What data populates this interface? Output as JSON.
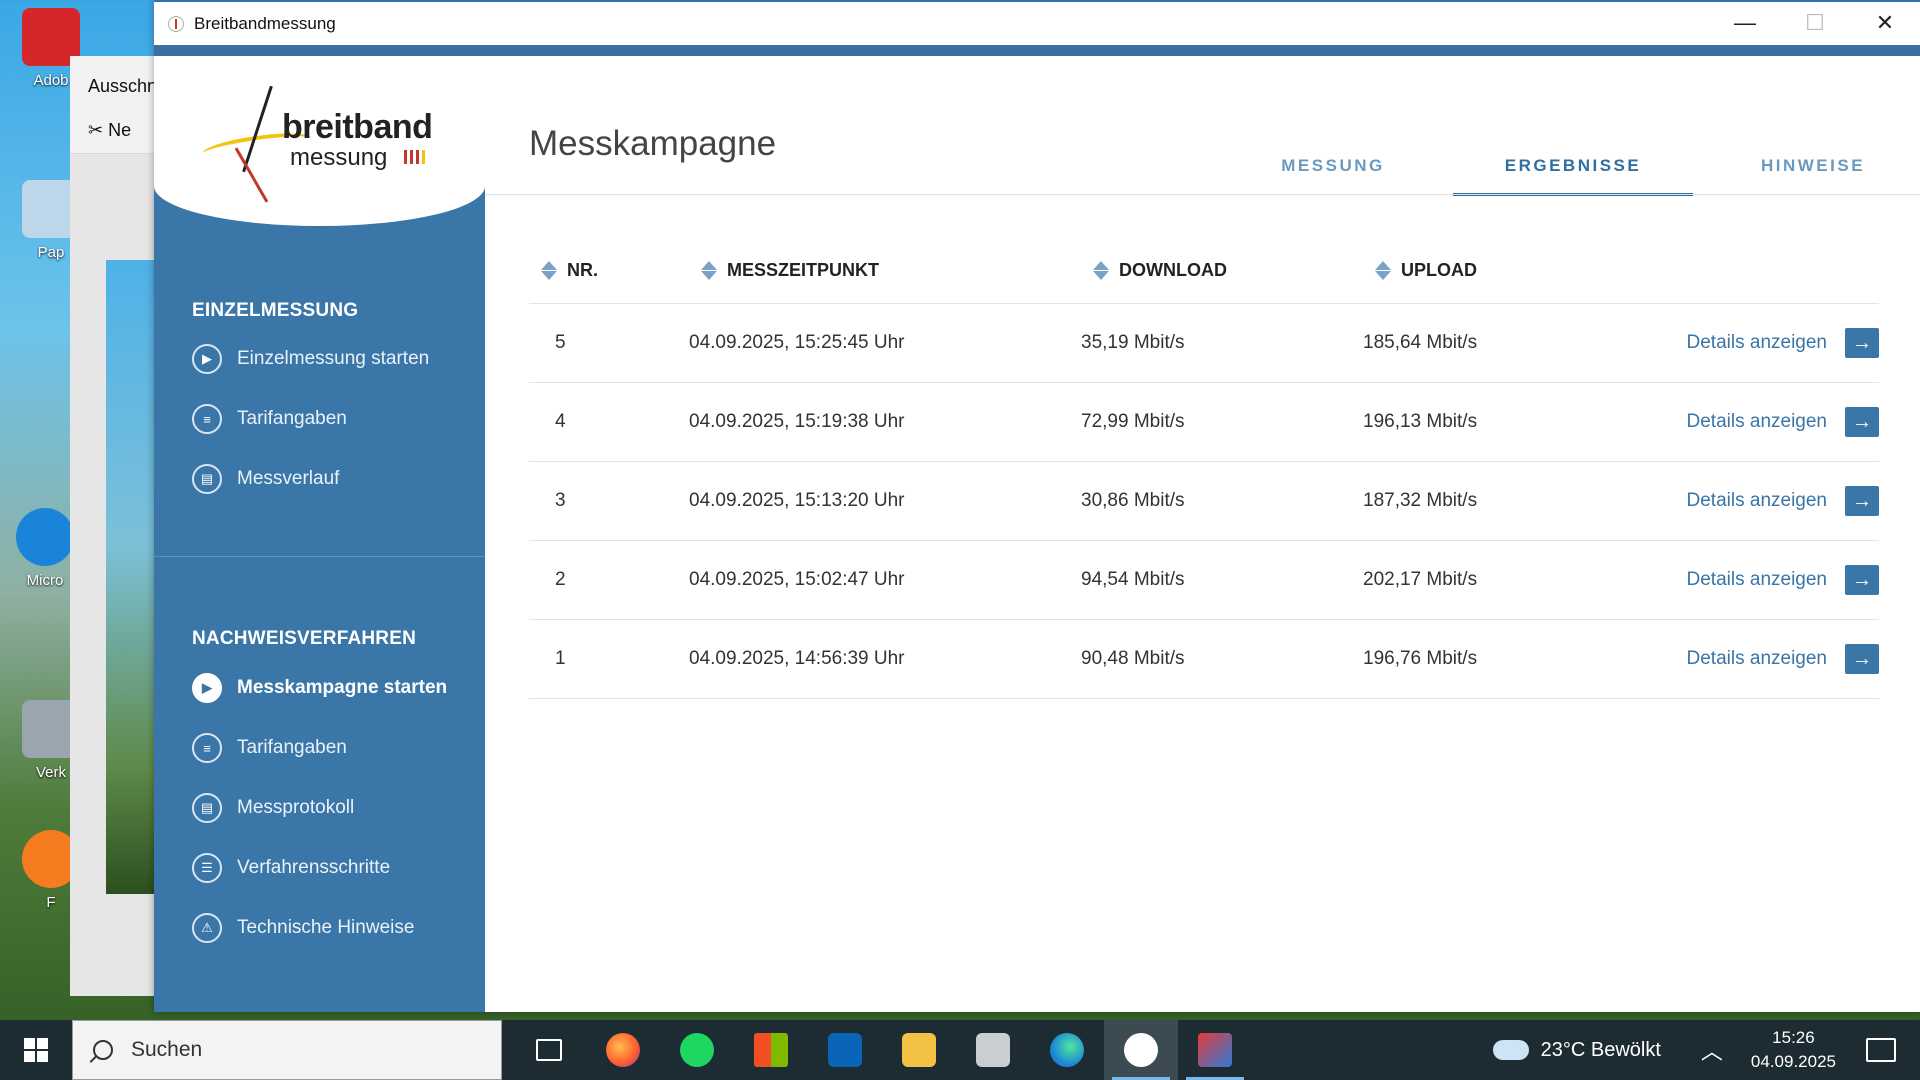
{
  "desktop": {
    "icons": [
      "Adob",
      "Pap",
      "Micro",
      "Verk",
      "F"
    ]
  },
  "snipping_tool": {
    "title": "Ausschn",
    "new_label": "Ne"
  },
  "window": {
    "title": "Breitbandmessung",
    "controls": {
      "minimize": "—",
      "maximize": "☐",
      "close": "✕"
    }
  },
  "logo": {
    "line1": "breitband",
    "line2": "messung"
  },
  "sidebar": {
    "section1": {
      "title": "EINZELMESSUNG",
      "items": [
        {
          "label": "Einzelmessung starten",
          "icon": "play-icon"
        },
        {
          "label": "Tarifangaben",
          "icon": "user-card-icon"
        },
        {
          "label": "Messverlauf",
          "icon": "document-icon"
        }
      ]
    },
    "section2": {
      "title": "NACHWEISVERFAHREN",
      "items": [
        {
          "label": "Messkampagne starten",
          "icon": "play-icon",
          "active": true
        },
        {
          "label": "Tarifangaben",
          "icon": "user-card-icon"
        },
        {
          "label": "Messprotokoll",
          "icon": "document-icon"
        },
        {
          "label": "Verfahrensschritte",
          "icon": "list-icon"
        },
        {
          "label": "Technische Hinweise",
          "icon": "warning-icon"
        }
      ]
    }
  },
  "main": {
    "title": "Messkampagne",
    "tabs": [
      {
        "label": "MESSUNG",
        "active": false
      },
      {
        "label": "ERGEBNISSE",
        "active": true
      },
      {
        "label": "HINWEISE",
        "active": false
      }
    ],
    "table": {
      "headers": [
        "NR.",
        "MESSZEITPUNKT",
        "DOWNLOAD",
        "UPLOAD"
      ],
      "details_label": "Details anzeigen",
      "rows": [
        {
          "nr": "5",
          "time": "04.09.2025, 15:25:45 Uhr",
          "download": "35,19 Mbit/s",
          "upload": "185,64 Mbit/s"
        },
        {
          "nr": "4",
          "time": "04.09.2025, 15:19:38 Uhr",
          "download": "72,99 Mbit/s",
          "upload": "196,13 Mbit/s"
        },
        {
          "nr": "3",
          "time": "04.09.2025, 15:13:20 Uhr",
          "download": "30,86 Mbit/s",
          "upload": "187,32 Mbit/s"
        },
        {
          "nr": "2",
          "time": "04.09.2025, 15:02:47 Uhr",
          "download": "94,54 Mbit/s",
          "upload": "202,17 Mbit/s"
        },
        {
          "nr": "1",
          "time": "04.09.2025, 14:56:39 Uhr",
          "download": "90,48 Mbit/s",
          "upload": "196,76 Mbit/s"
        }
      ]
    }
  },
  "taskbar": {
    "search_placeholder": "Suchen",
    "weather": "23°C  Bewölkt",
    "time": "15:26",
    "date": "04.09.2025",
    "apps": [
      "task-view-icon",
      "firefox-icon",
      "spotify-icon",
      "store-icon",
      "outlook-icon",
      "explorer-icon",
      "notes-icon",
      "edge-icon",
      "breitbandmessung-icon",
      "snipping-tool-icon"
    ]
  },
  "colors": {
    "sidebar": "#3b76a8",
    "accent": "#2f6fa1",
    "taskbar": "#1d2b33"
  }
}
